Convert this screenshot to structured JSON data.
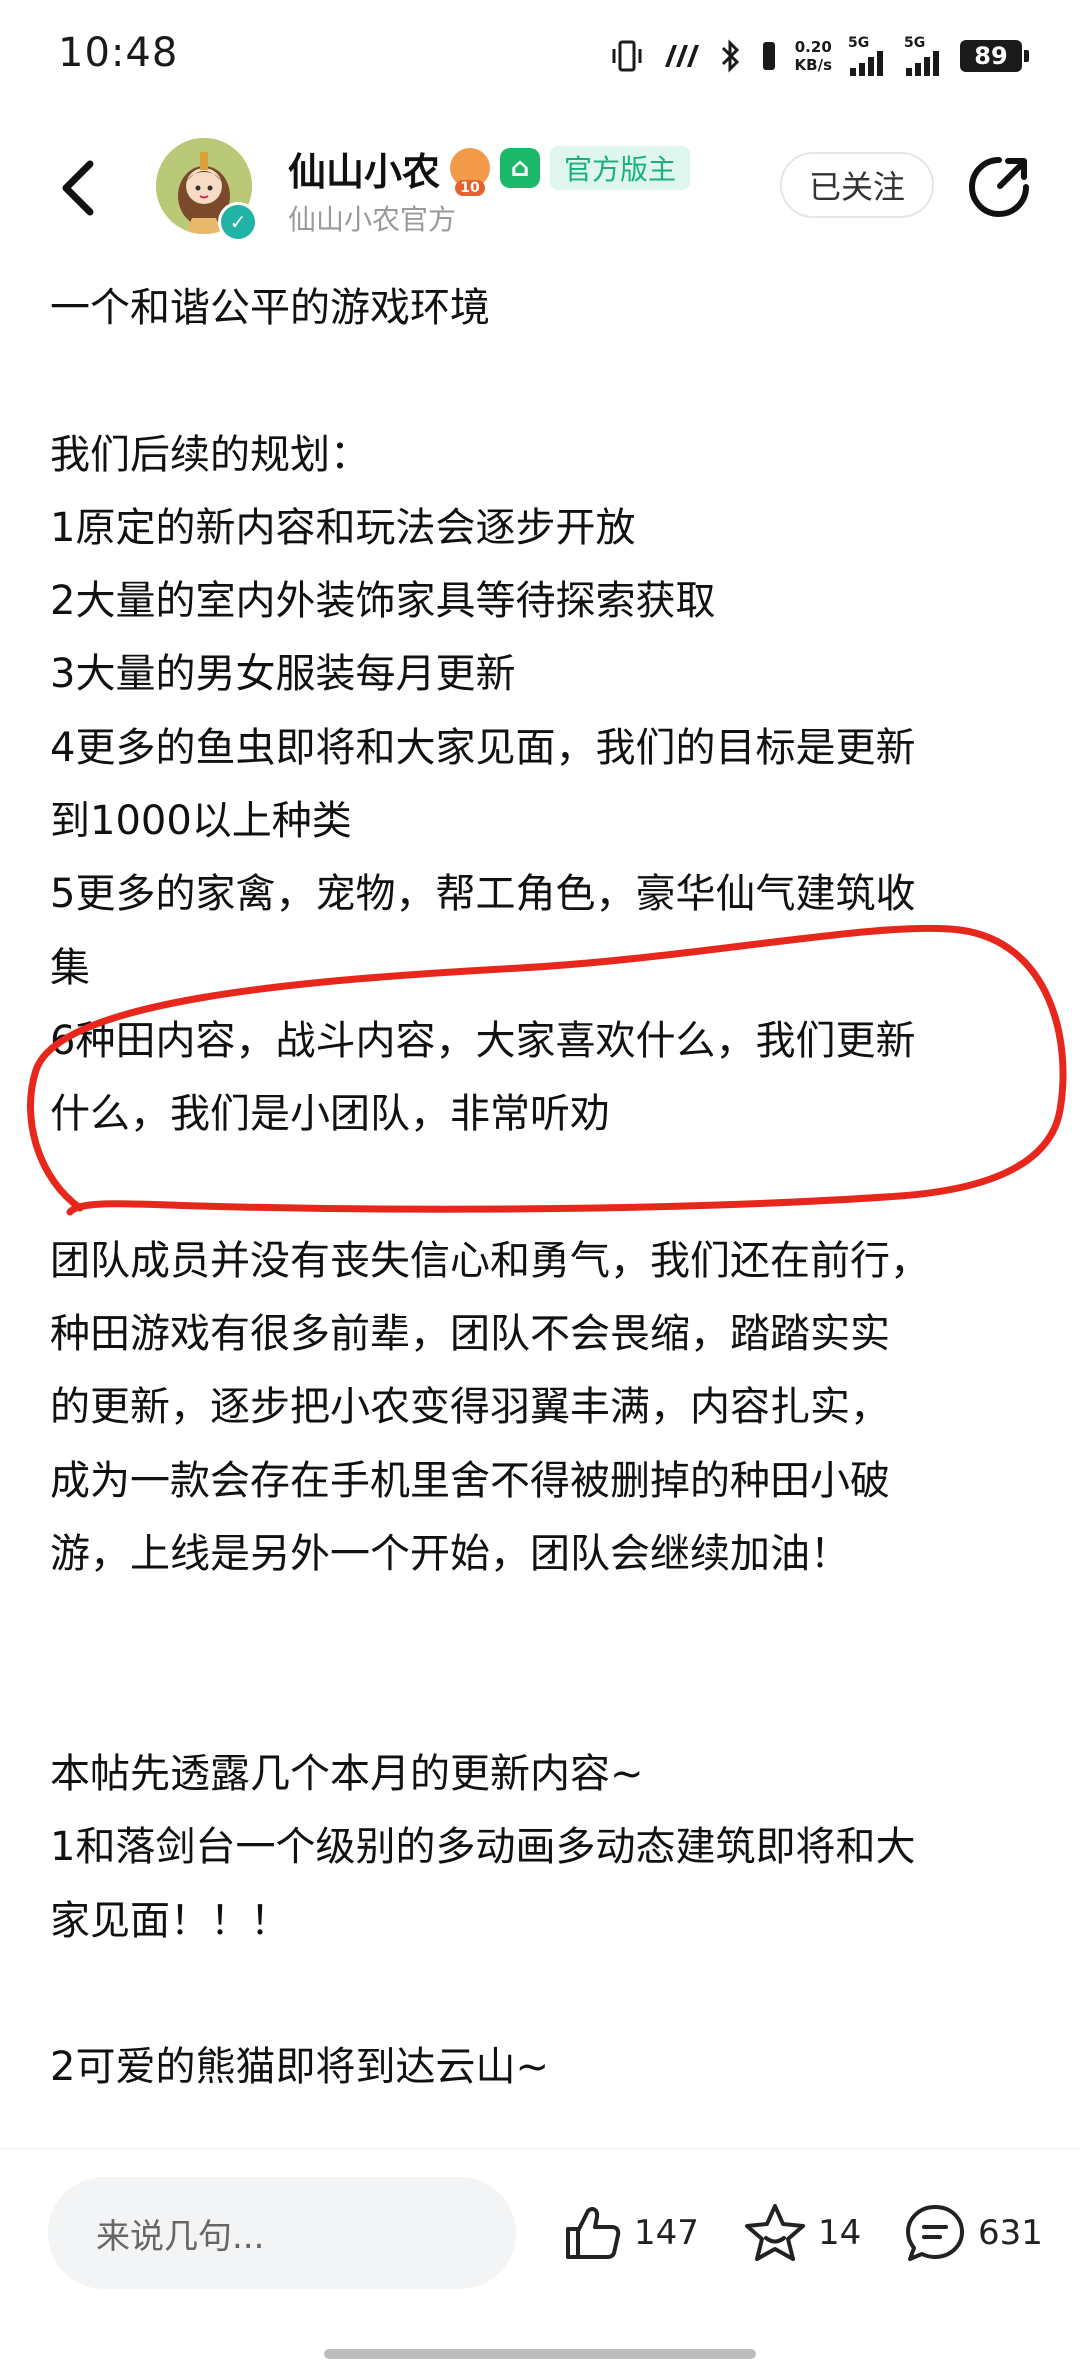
{
  "status_bar": {
    "time": "10:48",
    "net_speed_value": "0.20",
    "net_speed_unit": "KB/s",
    "signal1_label": "5G",
    "signal2_label": "5G",
    "battery": "89"
  },
  "header": {
    "name": "仙山小农",
    "level_badge": "10",
    "official_tag": "官方版主",
    "subtitle": "仙山小农官方",
    "follow_label": "已关注"
  },
  "content": {
    "cut_line": "一个和谐公平的游戏环境（截断行）",
    "paragraphs": [
      "一个和谐公平的游戏环境",
      "",
      "我们后续的规划：",
      "1原定的新内容和玩法会逐步开放",
      "2大量的室内外装饰家具等待探索获取",
      "3大量的男女服装每月更新",
      "4更多的鱼虫即将和大家见面，我们的目标是更新",
      "到1000以上种类",
      "5更多的家禽，宠物，帮工角色，豪华仙气建筑收",
      "集",
      "6种田内容，战斗内容，大家喜欢什么，我们更新",
      "什么，我们是小团队，非常听劝",
      "",
      "团队成员并没有丧失信心和勇气，我们还在前行，",
      "种田游戏有很多前辈，团队不会畏缩，踏踏实实",
      "的更新，逐步把小农变得羽翼丰满，内容扎实，",
      "成为一款会存在手机里舍不得被删掉的种田小破",
      "游，上线是另外一个开始，团队会继续加油！",
      "",
      "",
      "本帖先透露几个本月的更新内容~",
      "1和落剑台一个级别的多动画多动态建筑即将和大",
      "家见面！！！",
      "",
      "2可爱的熊猫即将到达云山~"
    ]
  },
  "bottom_bar": {
    "comment_placeholder": "来说几句...",
    "likes": "147",
    "favorites": "14",
    "comments": "631"
  },
  "colors": {
    "accent_green": "#16b17f",
    "annotation_red": "#e8271c"
  }
}
